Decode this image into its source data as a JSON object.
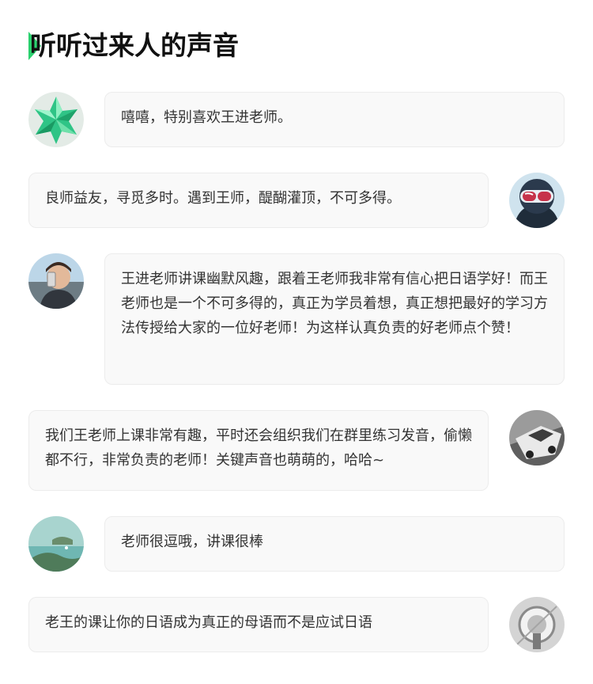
{
  "section": {
    "title": "听听过来人的声音",
    "accent_color": "#2bd26f"
  },
  "testimonials": [
    {
      "side": "left",
      "avatar": "green-star-icon",
      "text": "嘻嘻，特别喜欢王进老师。"
    },
    {
      "side": "right",
      "avatar": "ski-goggles-avatar",
      "text": "良师益友，寻觅多时。遇到王师，醍醐灌顶，不可多得。"
    },
    {
      "side": "left",
      "avatar": "selfie-avatar",
      "text": "王进老师讲课幽默风趣，跟着王老师我非常有信心把日语学好！而王老师也是一个不可多得的，真正为学员着想，真正想把最好的学习方法传授给大家的一位好老师！为这样认真负责的好老师点个赞！"
    },
    {
      "side": "right",
      "avatar": "car-avatar",
      "text": "我们王老师上课非常有趣，平时还会组织我们在群里练习发音，偷懒都不行，非常负责的老师！关键声音也萌萌的，哈哈~"
    },
    {
      "side": "left",
      "avatar": "lake-avatar",
      "text": "老师很逗哦，讲课很棒"
    },
    {
      "side": "right",
      "avatar": "monochrome-avatar",
      "text": "老王的课让你的日语成为真正的母语而不是应试日语"
    }
  ]
}
